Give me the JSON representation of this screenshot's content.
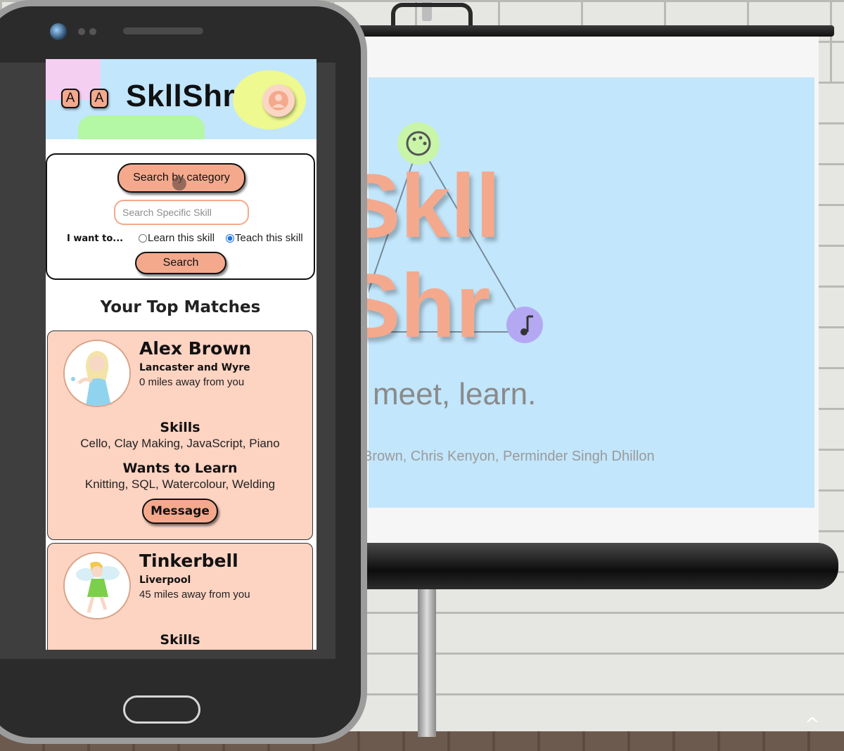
{
  "app": {
    "logo": "SkllShr",
    "font_buttons": [
      "A",
      "A"
    ],
    "search": {
      "category_button": "Search by category",
      "skill_placeholder": "Search Specific Skill",
      "want_label": "I want to...",
      "option_learn": "Learn this skill",
      "option_teach": "Teach this skill",
      "selected_option": "teach",
      "search_button": "Search"
    },
    "matches_title": "Your Top Matches",
    "matches": [
      {
        "name": "Alex Brown",
        "location": "Lancaster and Wyre",
        "distance": "0 miles away from you",
        "skills_heading": "Skills",
        "skills": "Cello, Clay Making, JavaScript, Piano",
        "wants_heading": "Wants to Learn",
        "wants": "Knitting, SQL, Watercolour, Welding",
        "message_button": "Message"
      },
      {
        "name": "Tinkerbell",
        "location": "Liverpool",
        "distance": "45 miles away from you",
        "skills_heading": "Skills"
      }
    ]
  },
  "slide": {
    "title_line1": "Skll",
    "title_line2": "Shr",
    "tagline": "meet, learn.",
    "authors": "Brown, Chris Kenyon, Perminder Singh Dhillon"
  },
  "colors": {
    "accent": "#f4a98d",
    "header_bg": "#c2e6fb",
    "card_bg": "#fdd3c2",
    "blob_pink": "#f5cff2",
    "blob_green": "#b4f7a4",
    "blob_yellow": "#eef98f"
  }
}
